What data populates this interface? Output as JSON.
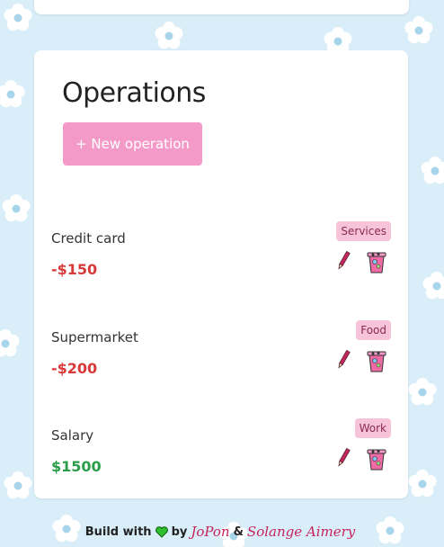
{
  "operations": {
    "title": "Operations",
    "new_button_label": "+ New operation",
    "items": [
      {
        "description": "Credit card",
        "amount": "-$150",
        "type": "expense",
        "category": "Services"
      },
      {
        "description": "Supermarket",
        "amount": "-$200",
        "type": "expense",
        "category": "Food"
      },
      {
        "description": "Salary",
        "amount": "$1500",
        "type": "income",
        "category": "Work"
      }
    ]
  },
  "footer": {
    "build_with": "Build with",
    "by": "by",
    "author1": "JoPon",
    "amp": "&",
    "author2": "Solange Aimery"
  },
  "icons": {
    "edit": "pencil-icon",
    "delete": "trash-bin-icon",
    "heart": "green-heart-icon"
  },
  "colors": {
    "background": "#d9eef8",
    "accent": "#f49ac9",
    "expense": "#d83a3a",
    "income": "#2a9d4b",
    "tag_bg": "#f7c3d9"
  }
}
